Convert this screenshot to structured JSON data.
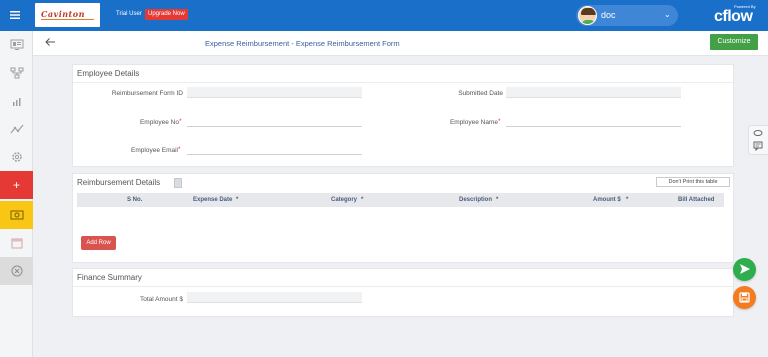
{
  "topbar": {
    "logo_text": "Cavinton",
    "trial_label": "Trial User",
    "upgrade_label": "Upgrade Now",
    "user_name": "doc",
    "powered_by": "Powered By",
    "brand": "cflow"
  },
  "header": {
    "title": "Expense Reimbursement - Expense Reimbursement Form",
    "customize_label": "Customize"
  },
  "employee_details": {
    "title": "Employee Details",
    "fields": {
      "form_id": {
        "label": "Reimbursement Form ID",
        "value": ""
      },
      "submitted_date": {
        "label": "Submitted Date",
        "value": ""
      },
      "employee_no": {
        "label": "Employee No",
        "value": ""
      },
      "employee_name": {
        "label": "Employee Name",
        "value": ""
      },
      "employee_email": {
        "label": "Employee Email",
        "value": ""
      }
    },
    "required_mark": "*"
  },
  "reimbursement": {
    "title": "Reimbursement Details",
    "no_print_label": "Don't Print this table",
    "columns": {
      "sno": "S No.",
      "expense_date": "Expense Date",
      "category": "Category",
      "description": "Description",
      "amount": "Amount $",
      "bill": "Bill Attached"
    },
    "add_row_label": "Add Row"
  },
  "finance": {
    "title": "Finance Summary",
    "total_label": "Total Amount $",
    "total_value": ""
  },
  "icons": {
    "menu": "hamburger-icon",
    "back": "arrow-left-icon",
    "send": "send-icon",
    "save": "save-icon"
  },
  "colors": {
    "topbar": "#1a6fc9",
    "upgrade": "#e53935",
    "customize": "#43a047",
    "add_row": "#d9534f",
    "sidebar_active": "#f9c613"
  }
}
